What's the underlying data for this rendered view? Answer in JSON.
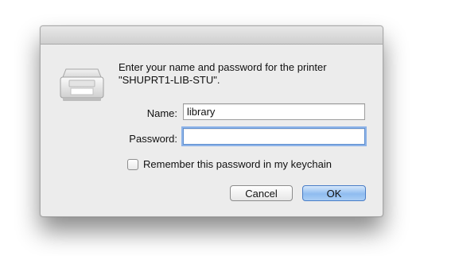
{
  "dialog": {
    "message_line1": "Enter your name and password for the printer",
    "message_line2": "\"SHUPRT1-LIB-STU\"."
  },
  "form": {
    "name_label": "Name:",
    "name_value": "library",
    "password_label": "Password:",
    "password_value": "",
    "remember_label": "Remember this password in my keychain",
    "remember_checked": false
  },
  "buttons": {
    "cancel_label": "Cancel",
    "ok_label": "OK"
  },
  "icons": {
    "printer": "printer-icon"
  },
  "colors": {
    "default_button": "#8fbcf0",
    "focus_ring": "#8db3e8",
    "dialog_background": "#ececec"
  }
}
